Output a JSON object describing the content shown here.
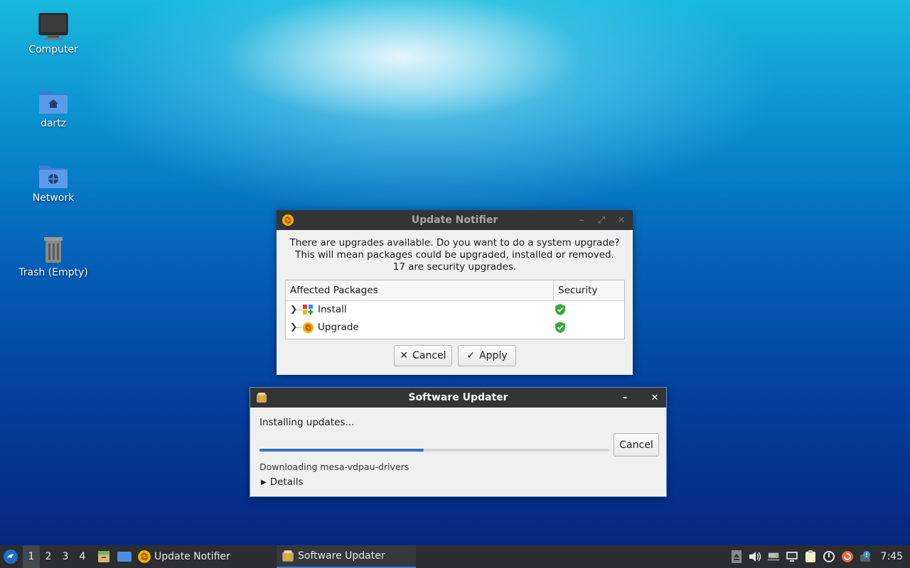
{
  "desktop": {
    "icons": [
      {
        "label": "Computer"
      },
      {
        "label": "dartz"
      },
      {
        "label": "Network"
      },
      {
        "label": "Trash (Empty)"
      }
    ]
  },
  "update_notifier": {
    "title": "Update Notifier",
    "message_line1": "There are upgrades available. Do you want to do a system upgrade?",
    "message_line2": "This will mean packages could be upgraded, installed or removed.",
    "message_line3": "17 are security upgrades.",
    "columns": [
      "Affected Packages",
      "Security"
    ],
    "rows": [
      {
        "label": "Install"
      },
      {
        "label": "Upgrade"
      }
    ],
    "cancel_label": "Cancel",
    "apply_label": "Apply"
  },
  "software_updater": {
    "title": "Software Updater",
    "status": "Installing updates...",
    "progress": 0.47,
    "cancel_label": "Cancel",
    "detail_text": "Downloading mesa-vdpau-drivers",
    "details_label": "Details"
  },
  "taskbar": {
    "workspaces": [
      "1",
      "2",
      "3",
      "4"
    ],
    "tasks": [
      {
        "label": "Update Notifier"
      },
      {
        "label": "Software Updater"
      }
    ],
    "clock": "7:45"
  },
  "colors": {
    "accent": "#2f74c0",
    "titlebar": "#333436",
    "taskbar": "#2b2d31",
    "shield": "#3aa83a"
  }
}
